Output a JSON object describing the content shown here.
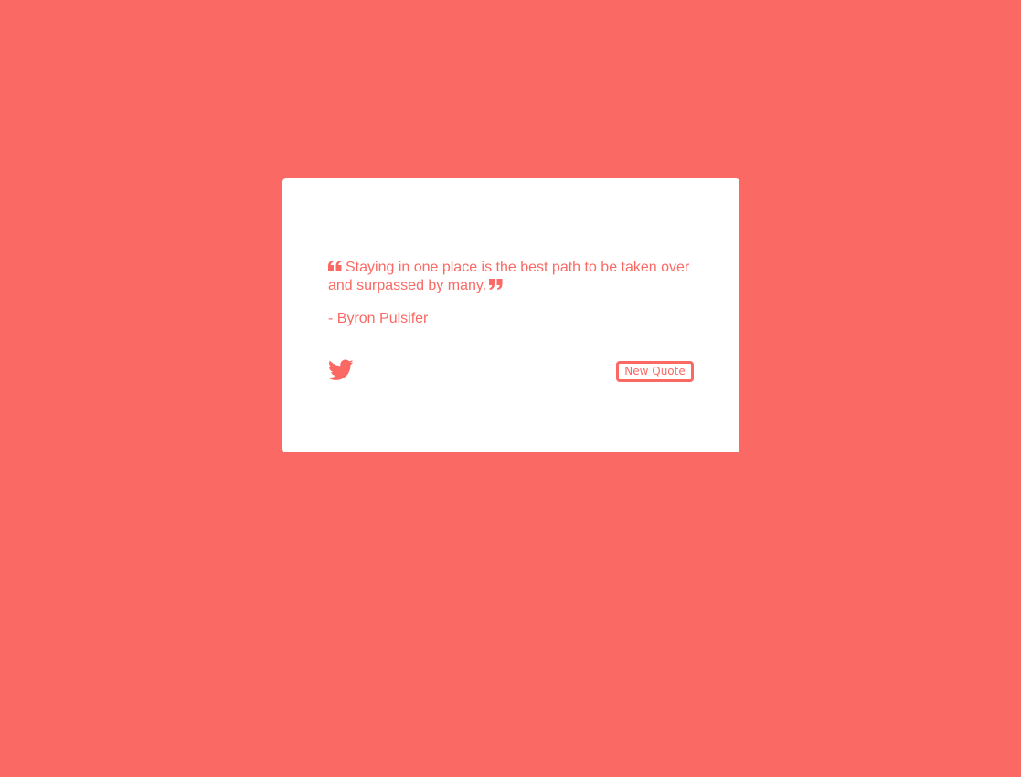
{
  "colors": {
    "background": "#fb6964",
    "card": "#ffffff",
    "accent": "#fb6964"
  },
  "quote": {
    "text": "Staying in one place is the best path to be taken over and surpassed by many.",
    "author": "- Byron Pulsifer",
    "open_icon": "quote-left-icon",
    "close_icon": "quote-right-icon"
  },
  "actions": {
    "tweet_icon": "twitter-icon",
    "new_quote_label": "New Quote"
  }
}
